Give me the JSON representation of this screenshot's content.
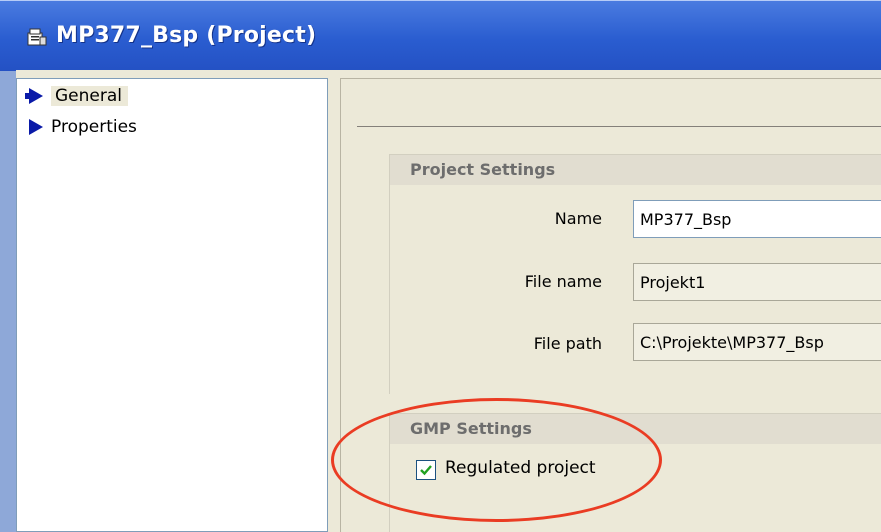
{
  "window": {
    "title": "MP377_Bsp (Project)",
    "title_icon": "project-properties-icon"
  },
  "nav": {
    "items": [
      {
        "label": "General",
        "icon": "arrow-right-icon",
        "selected": true
      },
      {
        "label": "Properties",
        "icon": "arrow-right-icon",
        "selected": false
      }
    ]
  },
  "project_settings": {
    "header": "Project Settings",
    "name_label": "Name",
    "name_value": "MP377_Bsp",
    "file_name_label": "File name",
    "file_name_value": "Projekt1",
    "file_path_label": "File path",
    "file_path_value": "C:\\Projekte\\MP377_Bsp"
  },
  "gmp_settings": {
    "header": "GMP Settings",
    "regulated_label": "Regulated project",
    "regulated_checked": true
  },
  "colors": {
    "titlebar": "#2a5dd0",
    "nav_arrow": "#0a1aa8",
    "annotation": "#ea3c23",
    "checkmark": "#21a121"
  }
}
